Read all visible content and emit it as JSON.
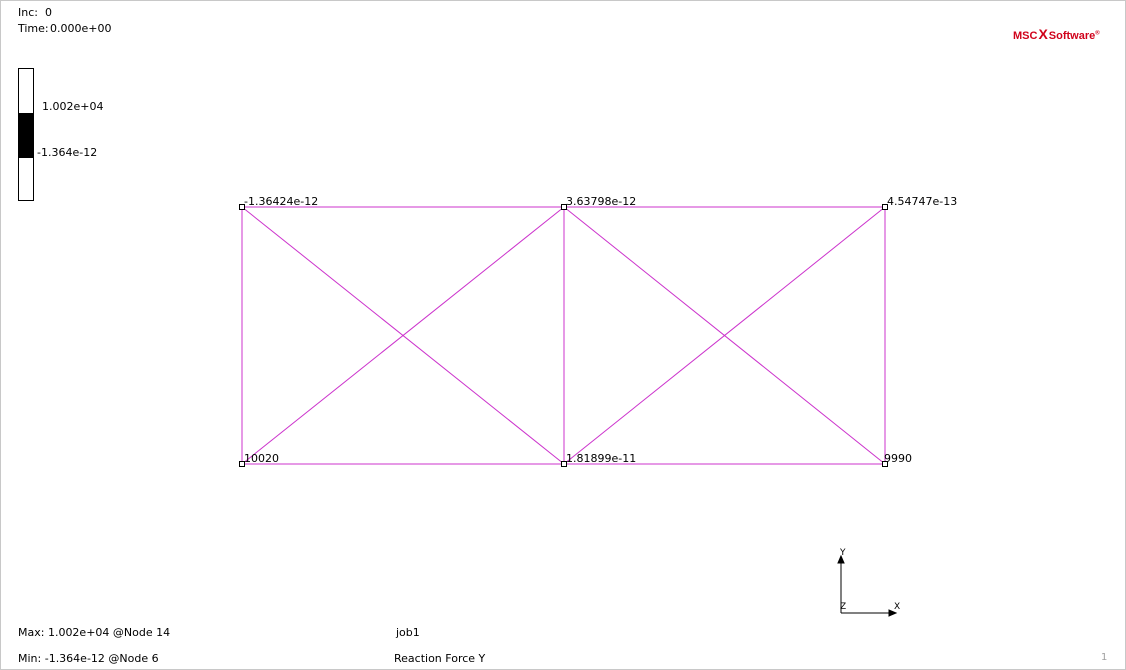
{
  "header": {
    "inc_label": "Inc:",
    "inc_value": "0",
    "time_label": "Time:",
    "time_value": "0.000e+00"
  },
  "legend": {
    "max_value": "1.002e+04",
    "min_value": "-1.364e-12",
    "band_color": "#000000"
  },
  "logo": {
    "left_text": "MSC",
    "x_text": "X",
    "right_text": "Software",
    "trademark": "®",
    "color": "#d0021b"
  },
  "mesh": {
    "element_color": "#cc33cc",
    "node_labels": [
      "-1.36424e-12",
      "3.63798e-12",
      "4.54747e-13",
      "10020",
      "1.81899e-11",
      "9990"
    ]
  },
  "triad": {
    "x_label": "X",
    "y_label": "Y",
    "z_label": "Z"
  },
  "footer": {
    "max_text": "Max: 1.002e+04 @Node 14",
    "min_text": "Min: -1.364e-12 @Node 6",
    "job_name": "job1",
    "result_name": "Reaction Force Y",
    "page_number": "1"
  }
}
